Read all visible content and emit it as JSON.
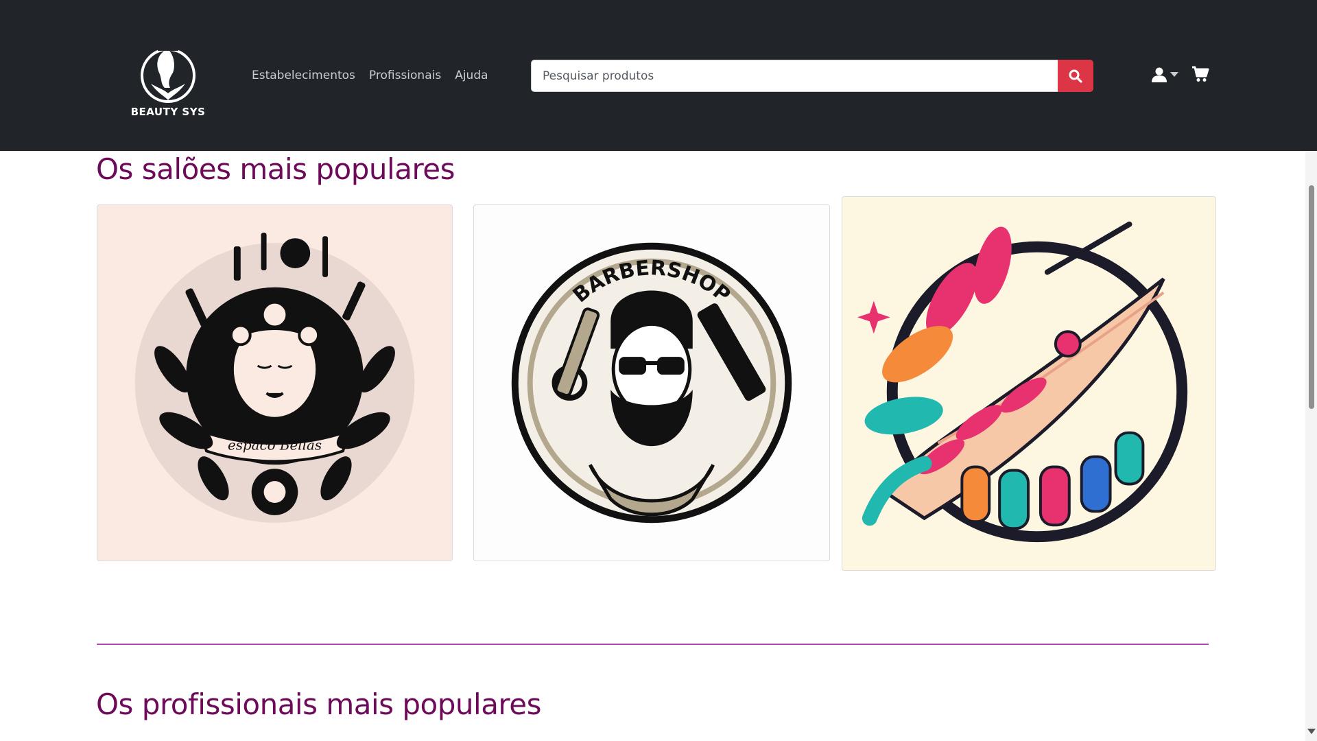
{
  "brand": {
    "name": "BEAUTY SYS"
  },
  "nav": {
    "items": [
      {
        "label": "Estabelecimentos"
      },
      {
        "label": "Profissionais"
      },
      {
        "label": "Ajuda"
      }
    ]
  },
  "search": {
    "placeholder": "Pesquisar produtos",
    "icon": "search-icon"
  },
  "header_icons": {
    "user": "user-icon",
    "cart": "cart-icon"
  },
  "sections": {
    "salons": {
      "title": "Os salões mais populares",
      "cards": [
        {
          "logo_text": "espaco Bellas"
        },
        {
          "logo_text": "BARBERSHOP"
        },
        {
          "logo_text": ""
        }
      ]
    },
    "professionals": {
      "title": "Os profissionais mais populares"
    }
  },
  "colors": {
    "header_bg": "#212529",
    "accent": "#6d0b5a",
    "search_button": "#dc3545",
    "divider": "#b344b8"
  }
}
